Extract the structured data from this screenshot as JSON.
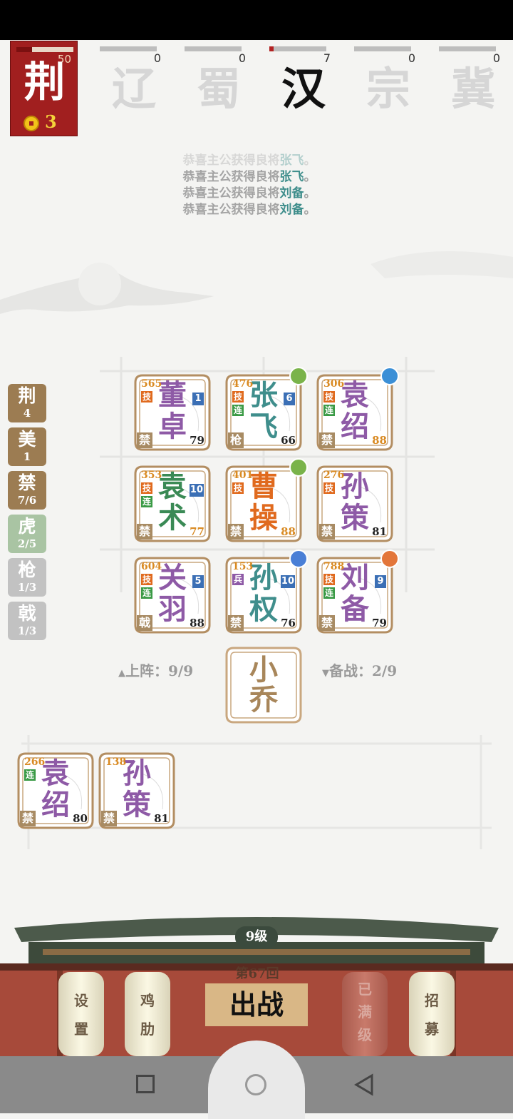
{
  "colors": {
    "accent_red": "#a11f1f",
    "gold": "#f2c21a",
    "teal_name": "#3f8e8c"
  },
  "header": {
    "my_faction": {
      "name": "荆",
      "count": "50",
      "coins": "3",
      "progress_fraction": 0.27
    },
    "factions": [
      {
        "name": "辽",
        "count": "0",
        "active": false,
        "progress_fraction": 0
      },
      {
        "name": "蜀",
        "count": "0",
        "active": false,
        "progress_fraction": 0
      },
      {
        "name": "汉",
        "count": "7",
        "active": true,
        "progress_fraction": 0.08
      },
      {
        "name": "宗",
        "count": "0",
        "active": false,
        "progress_fraction": 0
      },
      {
        "name": "冀",
        "count": "0",
        "active": false,
        "progress_fraction": 0
      }
    ]
  },
  "messages": [
    {
      "prefix": "恭喜主公获得良将",
      "hero": "张飞",
      "suffix": "。"
    },
    {
      "prefix": "恭喜主公获得良将",
      "hero": "张飞",
      "suffix": "。"
    },
    {
      "prefix": "恭喜主公获得良将",
      "hero": "刘备",
      "suffix": "。"
    },
    {
      "prefix": "恭喜主公获得良将",
      "hero": "刘备",
      "suffix": "。"
    }
  ],
  "traits": [
    {
      "name": "荆",
      "count": "4",
      "state": "active"
    },
    {
      "name": "美",
      "count": "1",
      "state": "active"
    },
    {
      "name": "禁",
      "count": "7/6",
      "state": "active"
    },
    {
      "name": "虎",
      "count": "2/5",
      "state": "partial"
    },
    {
      "name": "枪",
      "count": "1/3",
      "state": "inactive"
    },
    {
      "name": "戟",
      "count": "1/3",
      "state": "inactive"
    }
  ],
  "board": [
    {
      "l1": "董",
      "l2": "卓",
      "power": "565",
      "level": "79",
      "cls": "禁",
      "tags": [
        "技"
      ],
      "star": "1",
      "badge": "",
      "name_color": "#8e5aa6",
      "level_color": "#222"
    },
    {
      "l1": "张",
      "l2": "飞",
      "power": "476",
      "level": "66",
      "cls": "枪",
      "tags": [
        "技",
        "连"
      ],
      "star": "6",
      "badge": "sword",
      "name_color": "#3f8e8c",
      "level_color": "#222"
    },
    {
      "l1": "袁",
      "l2": "绍",
      "power": "306",
      "level": "88",
      "cls": "禁",
      "tags": [
        "技",
        "连"
      ],
      "star": "",
      "badge": "blue",
      "name_color": "#8e5aa6",
      "level_color": "#d98a22"
    },
    {
      "l1": "袁",
      "l2": "术",
      "power": "353",
      "level": "77",
      "cls": "禁",
      "tags": [
        "技",
        "连"
      ],
      "star": "10",
      "badge": "",
      "name_color": "#3a8a55",
      "level_color": "#d98a22"
    },
    {
      "l1": "曹",
      "l2": "操",
      "power": "401",
      "level": "88",
      "cls": "禁",
      "tags": [
        "技"
      ],
      "star": "",
      "badge": "sword",
      "name_color": "#e06a1e",
      "level_color": "#d98a22"
    },
    {
      "l1": "孙",
      "l2": "策",
      "power": "276",
      "level": "81",
      "cls": "禁",
      "tags": [
        "技"
      ],
      "star": "",
      "badge": "",
      "name_color": "#8e5aa6",
      "level_color": "#222"
    },
    {
      "l1": "关",
      "l2": "羽",
      "power": "604",
      "level": "88",
      "cls": "戟",
      "tags": [
        "技",
        "连"
      ],
      "star": "5",
      "badge": "",
      "name_color": "#8e5aa6",
      "level_color": "#222"
    },
    {
      "l1": "孙",
      "l2": "权",
      "power": "153",
      "level": "76",
      "cls": "禁",
      "tags": [
        "兵"
      ],
      "star": "10",
      "badge": "horn",
      "name_color": "#3f8e8c",
      "level_color": "#222"
    },
    {
      "l1": "刘",
      "l2": "备",
      "power": "788",
      "level": "79",
      "cls": "禁",
      "tags": [
        "技",
        "连"
      ],
      "star": "9",
      "badge": "orange",
      "name_color": "#8e5aa6",
      "level_color": "#222"
    }
  ],
  "deploy": {
    "label": "上阵：9/9",
    "arrow": "▲"
  },
  "reserve": {
    "label": "备战：2/9",
    "arrow": "▼"
  },
  "center_hero": {
    "l1": "小",
    "l2": "乔"
  },
  "bench": [
    {
      "l1": "袁",
      "l2": "绍",
      "power": "266",
      "level": "80",
      "cls": "禁",
      "tags": [
        "连"
      ],
      "name_color": "#8e5aa6"
    },
    {
      "l1": "孙",
      "l2": "策",
      "power": "138",
      "level": "81",
      "cls": "禁",
      "tags": [],
      "name_color": "#8e5aa6"
    }
  ],
  "footer": {
    "level": "9级",
    "round": "第67回",
    "battle": "出战",
    "buttons": [
      {
        "name": "settings",
        "chars": [
          "设",
          "置"
        ],
        "enabled": true
      },
      {
        "name": "chicken-rib",
        "chars": [
          "鸡",
          "肋"
        ],
        "enabled": true
      },
      {
        "name": "maxed",
        "chars": [
          "已",
          "满",
          "级"
        ],
        "enabled": false
      },
      {
        "name": "recruit",
        "chars": [
          "招",
          "募"
        ],
        "enabled": true
      }
    ]
  }
}
